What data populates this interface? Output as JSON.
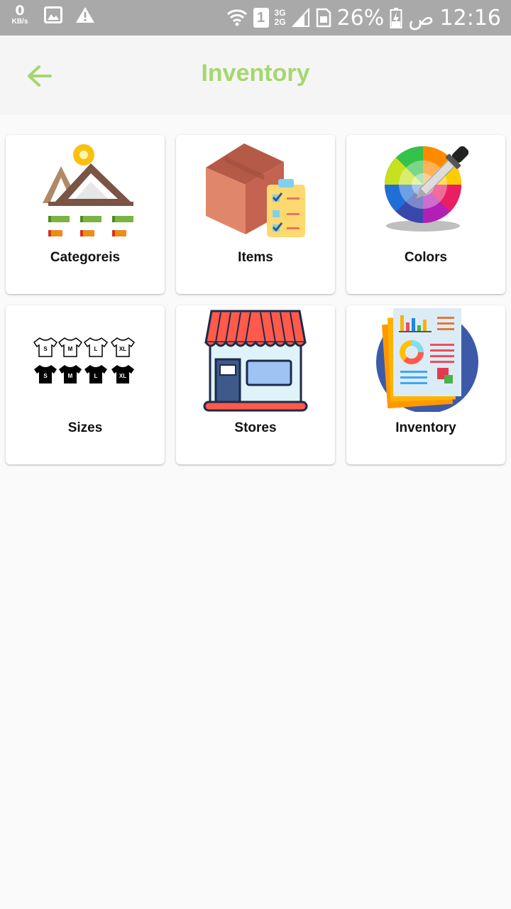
{
  "status_bar": {
    "net_speed_value": "0",
    "net_speed_unit": "KB/s",
    "sim_slot": "1",
    "net_3g": "3G",
    "net_2g": "2G",
    "battery": "26%",
    "ampm": "ص",
    "time": "12:16"
  },
  "header": {
    "title": "Inventory",
    "back_icon": "arrow-back-icon",
    "accent_color": "#a5d76e"
  },
  "menu": {
    "items": [
      {
        "label": "Categoreis",
        "icon": "categories-icon"
      },
      {
        "label": "Items",
        "icon": "items-box-icon"
      },
      {
        "label": "Colors",
        "icon": "color-picker-icon"
      },
      {
        "label": "Sizes",
        "icon": "tshirt-sizes-icon"
      },
      {
        "label": "Stores",
        "icon": "store-icon"
      },
      {
        "label": "Inventory",
        "icon": "inventory-report-icon"
      }
    ],
    "size_labels": [
      "S",
      "M",
      "L",
      "XL"
    ]
  }
}
